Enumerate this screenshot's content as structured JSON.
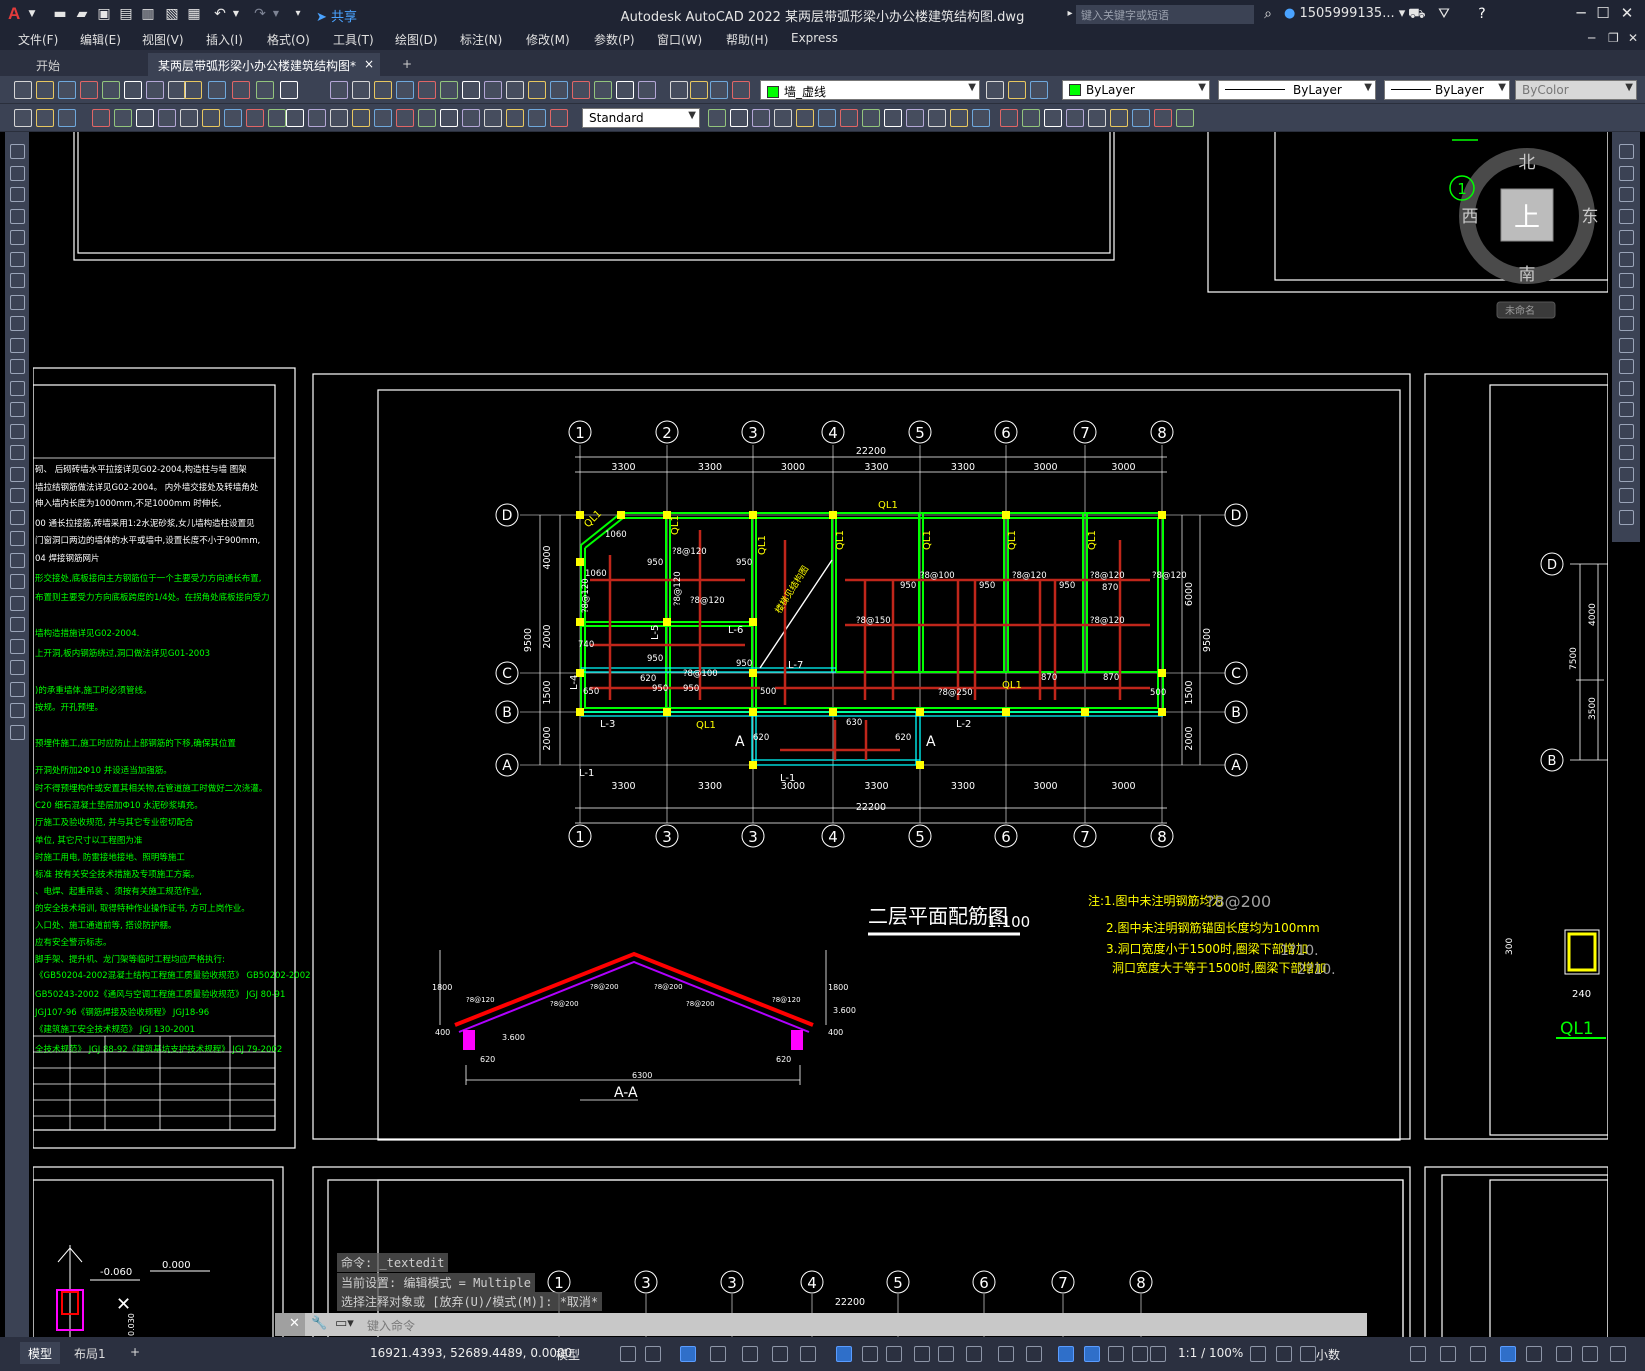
{
  "title_bar": {
    "app_title": "Autodesk AutoCAD 2022    某两层带弧形梁小办公楼建筑结构图.dwg",
    "share_label": "共享",
    "search_placeholder": "键入关键字或短语",
    "user_name": "1505999135...",
    "logo": "A"
  },
  "menu": {
    "items": [
      "文件(F)",
      "编辑(E)",
      "视图(V)",
      "插入(I)",
      "格式(O)",
      "工具(T)",
      "绘图(D)",
      "标注(N)",
      "修改(M)",
      "参数(P)",
      "窗口(W)",
      "帮助(H)",
      "Express"
    ]
  },
  "tabs": {
    "start": "开始",
    "document": "某两层带弧形梁小办公楼建筑结构图*",
    "close": "×",
    "add": "+"
  },
  "toolbar": {
    "layer_name": "墙_虚线",
    "color_combo": "ByLayer",
    "linetype_combo": "ByLayer",
    "lineweight_combo": "ByLayer",
    "plotstyle_combo": "ByColor",
    "text_style": "Standard"
  },
  "viewcube": {
    "north": "北",
    "south": "南",
    "east": "东",
    "west": "西",
    "top": "上",
    "circle_num": "1",
    "wcs": "未命名"
  },
  "plan": {
    "grid_top": [
      "1",
      "2",
      "3",
      "4",
      "5",
      "6",
      "7",
      "8"
    ],
    "grid_bottom": [
      "1",
      "3",
      "3",
      "4",
      "5",
      "6",
      "7",
      "8"
    ],
    "grid_rows": [
      "D",
      "C",
      "B",
      "A"
    ],
    "dims_top": [
      "3300",
      "3300",
      "3000",
      "3300",
      "3300",
      "3000",
      "3000"
    ],
    "dims_bottom": [
      "3300",
      "3300",
      "3000",
      "3300",
      "3300",
      "3000",
      "3000"
    ],
    "total": "22200",
    "left_dims": [
      "4000",
      "2000",
      "1500",
      "2000"
    ],
    "left_total": "9500",
    "right_dims": [
      "6000",
      "1500",
      "2000"
    ],
    "right_total": "9500",
    "beam_labels": [
      "QL1",
      "QL1",
      "QL1",
      "QL1",
      "QL1",
      "QL1",
      "QL1",
      "QL1",
      "QL1",
      "QL1",
      "L-1",
      "L-2",
      "L-3",
      "L-4",
      "L-5",
      "L-6",
      "L-7"
    ],
    "rebar_labels": [
      "?8@120",
      "?8@120",
      "?8@100",
      "?8@120",
      "?8@120",
      "?8@120",
      "?8@150",
      "?8@120",
      "?8@250",
      "?8@100",
      "?8@120",
      "?8@120"
    ],
    "values": [
      "950",
      "950",
      "950",
      "950",
      "950",
      "950",
      "950",
      "950",
      "950",
      "870",
      "870",
      "870",
      "1060",
      "1060",
      "740",
      "620",
      "620",
      "620",
      "630",
      "500",
      "500",
      "650"
    ],
    "section_mark": "A",
    "stair_note": "楼梯见结构图",
    "title": "二层平面配筋图",
    "scale": "1:100"
  },
  "notes": {
    "line1": "注:1.图中未注明钢筋均为",
    "line1_spec": "?8@200",
    "line2": "2.图中未注明钢筋锚固长度均为100mm",
    "line3": "3.洞口宽度小于1500时,圈梁下部增加",
    "line3_spec": "1?10.",
    "line4": "洞口宽度大于等于1500时,圈梁下部增加",
    "line4_spec": "2?10."
  },
  "section_aa": {
    "label": "A-A",
    "dims": [
      "1800",
      "1800",
      "3.600",
      "3.600",
      "400",
      "400",
      "620",
      "620",
      "6300"
    ],
    "rebars": [
      "?8@120",
      "?8@200",
      "?8@200",
      "?8@200",
      "?8@200",
      "?8@200",
      "?8@120"
    ]
  },
  "right_detail": {
    "label": "QL1",
    "dim_w": "240",
    "dim_h": "300",
    "rows": [
      "D",
      "B"
    ],
    "dims": [
      "4000",
      "3500",
      "7500"
    ]
  },
  "left_notes": [
    "砌、 后砌砖墙水平拉接详见G02-2004,构造柱与墙 图架",
    "墙拉结钢筋做法详见G02-2004。 内外墙交接处及转墙角处",
    "伸入墙内长度为1000mm,不足1000mm 时伸长,",
    "00 通长拉接筋,砖墙采用1:2水泥砂浆,女儿墙构造柱设置见",
    "门窗洞口两边的墙体的水平或墙中,设置长度不小于900mm,",
    "04 焊接钢筋网片",
    "形交接处,底板接向主方钢筋位于一个主要受力方向通长布置,",
    "布置则主要受力方向底板跨度的1/4处。在拐角处底板接向受力",
    "墙构造措施详见G02-2004.",
    "上开洞,板内钢筋绕过,洞口做法详见G01-2003",
    ")的承重墙体,施工时必须管线。",
    "按规。开孔预埋。",
    "预埋件施工,施工时应防止上部钢筋的下移,确保其位置",
    "开洞处所加2Ф10 并设适当加强筋。",
    "时不得预埋构件或安置其相关物,在管道施工时做好二次浇灌。",
    "C20 细石混凝土垫层加Ф10 水泥砂浆填充。",
    "厅施工及验收规范, 并与其它专业密切配合",
    "单位, 其它尺寸以工程图为准",
    "时施工用电, 防雷接地接地、照明等施工",
    "标准 按有关安全技术措施及专项施工方案。",
    "、电焊、起重吊装 、须按有关施工规范作业,",
    "的安全技术培训, 取得特种作业操作证书, 方可上岗作业。",
    "入口处、施工通道前等, 搭设防护棚。",
    "应有安全警示标志。",
    "脚手架、提升机、龙门架等临时工程均应严格执行:",
    "《GB50204-2002混凝土结构工程施工质量验收规范》 GB50202-2002",
    "GB50243-2002《通风与空调工程施工质量验收规范》 JGJ 80-91",
    "JGJ107-96《钢筋焊接及验收规程》 JGJ18-96",
    "《建筑施工安全技术规范》 JGJ 130-2001",
    "全技术规范》 JGJ 88-92《建筑基坑支护技术规程》 JGJ 79-2002"
  ],
  "bottom_view": {
    "grid": [
      "1",
      "3",
      "3",
      "4",
      "5",
      "6",
      "7",
      "8"
    ],
    "dims": [
      "3300",
      "3300",
      "3000",
      "3300",
      "3300",
      "3000",
      "3000"
    ],
    "total": "22200",
    "level1": "0.000",
    "level2": "-0.060",
    "level3": "0.030"
  },
  "command": {
    "line1": "命令: _textedit",
    "line2": "当前设置: 编辑模式 = Multiple",
    "line3": "选择注释对象或 [放弃(U)/模式(M)]: *取消*",
    "placeholder": "键入命令"
  },
  "status": {
    "model_tab": "模型",
    "layout_tab": "布局1",
    "add_tab": "+",
    "coordinates": "16921.4393, 52689.4489, 0.0000",
    "model_label": "模型",
    "scale": "1:1 / 100%",
    "units": "小数"
  }
}
